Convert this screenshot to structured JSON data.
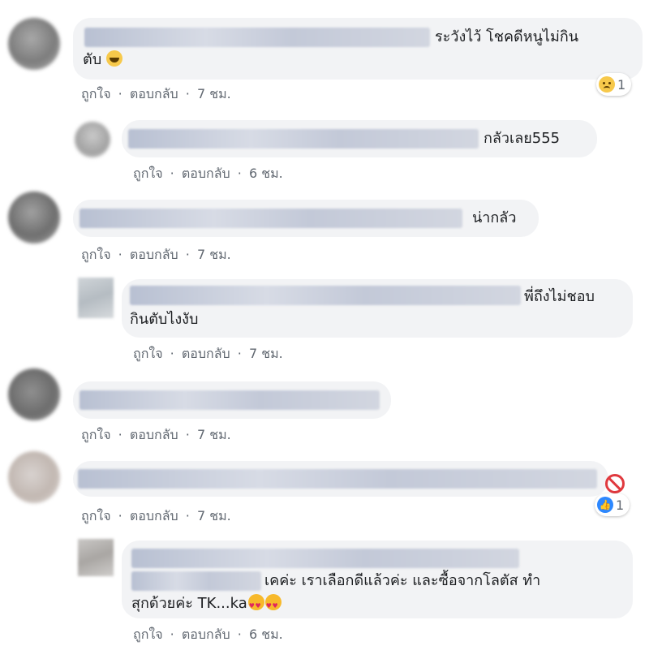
{
  "actions": {
    "like": "ถูกใจ",
    "reply": "ตอบกลับ",
    "separator": "·"
  },
  "comments": [
    {
      "text_line1": "ระวังไว้ โชคดีหนูไม่กิน",
      "text_line2": "ตับ",
      "time": "7 ชม.",
      "reaction_count": "1",
      "reaction_icon": "sad-emoji"
    },
    {
      "text_line1": "กลัวเลย555",
      "time": "6 ชม."
    },
    {
      "text_line1": "น่ากลัว",
      "time": "7 ชม."
    },
    {
      "text_line1": "พี่ถึงไม่ชอบ",
      "text_line2": "กินตับไงงับ",
      "time": "7 ชม."
    },
    {
      "time": "7 ชม."
    },
    {
      "time": "7 ชม.",
      "reaction_count": "1",
      "reaction_icon": "like-icon",
      "hidden_icon": "ban-icon"
    },
    {
      "text_line2": "เคค่ะ เราเลือกดีแล้วค่ะ และซื้อจากโลตัส ทำ",
      "text_line3": "สุกด้วยค่ะ TK...ka",
      "time": "6 ชม.",
      "emoji": "heart-eyes-emoji"
    }
  ]
}
